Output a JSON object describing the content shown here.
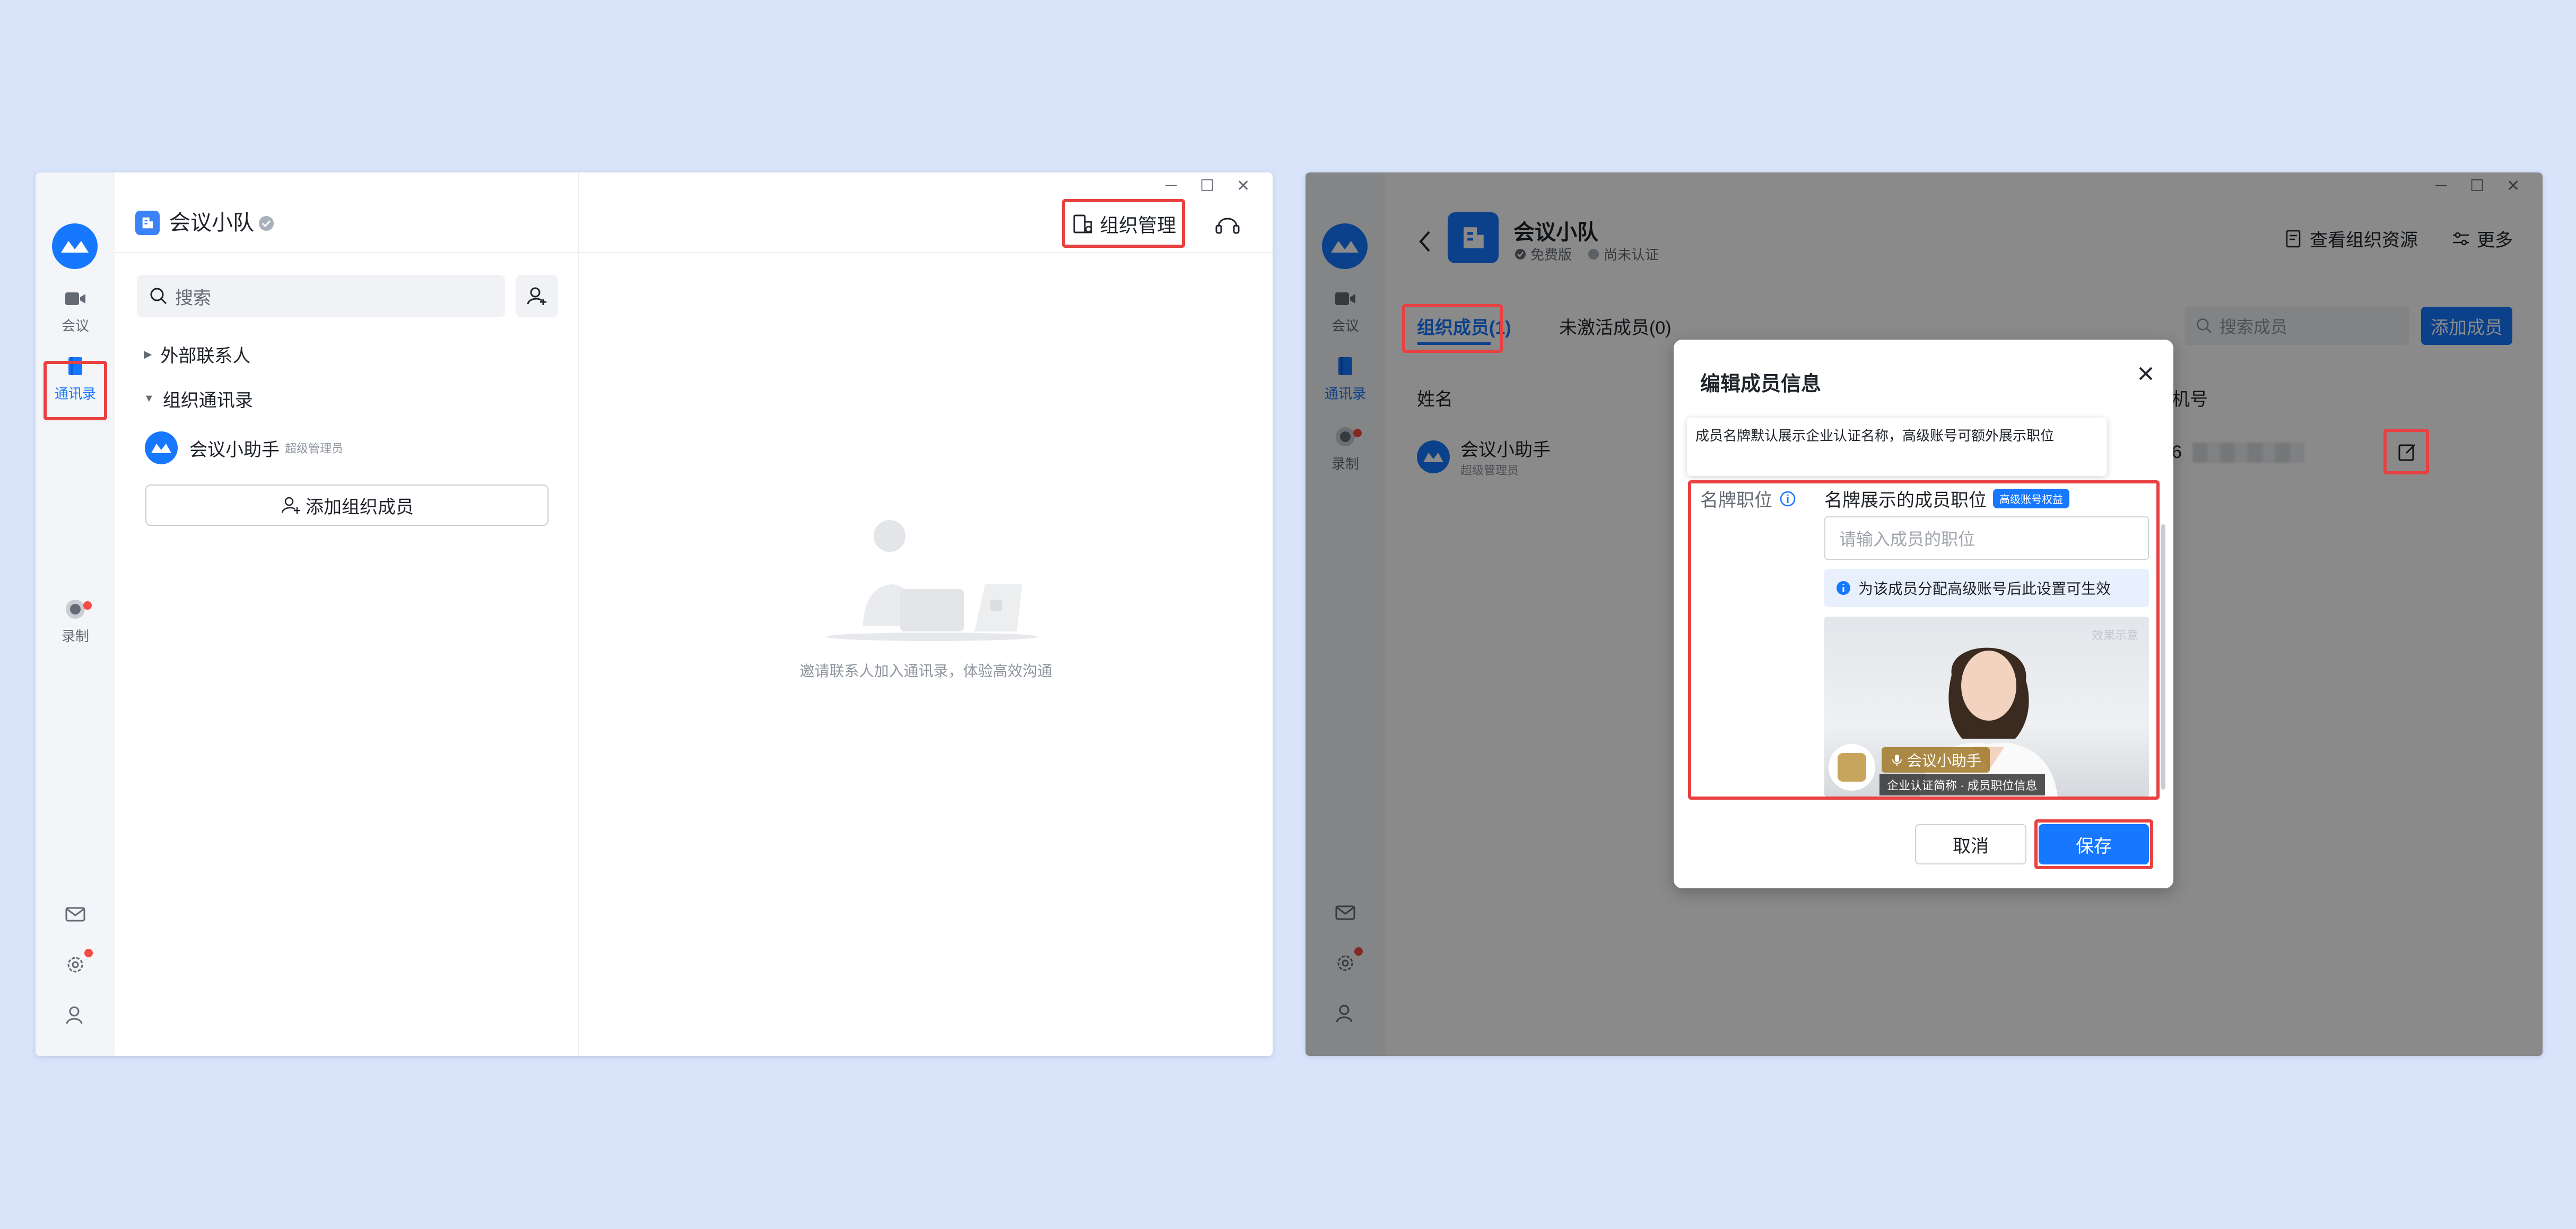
{
  "left_window": {
    "rail": {
      "meeting": "会议",
      "contacts": "通讯录",
      "record": "录制"
    },
    "title": "会议小队",
    "search_placeholder": "搜索",
    "tree": {
      "external": "外部联系人",
      "org": "组织通讯录"
    },
    "contact": {
      "name": "会议小助手",
      "role": "超级管理员"
    },
    "add_member": "添加组织成员",
    "empty_text": "邀请联系人加入通讯录，体验高效沟通",
    "org_manage": "组织管理"
  },
  "right_window": {
    "rail": {
      "meeting": "会议",
      "contacts": "通讯录",
      "record": "录制"
    },
    "org_name": "会议小队",
    "plan": "免费版",
    "cert": "尚未认证",
    "view_resources": "查看组织资源",
    "more": "更多",
    "tabs": {
      "members": "组织成员(1)",
      "inactive": "未激活成员(0)"
    },
    "search_placeholder": "搜索成员",
    "add_member": "添加成员",
    "columns": {
      "name": "姓名",
      "phone": "机号"
    },
    "member": {
      "name": "会议小助手",
      "role": "超级管理员",
      "phone_prefix": "6"
    },
    "modal": {
      "title": "编辑成员信息",
      "tooltip": "成员名牌默认展示企业认证名称，高级账号可额外展示职位",
      "label": "名牌职位",
      "field_title": "名牌展示的成员职位",
      "badge": "高级账号权益",
      "placeholder": "请输入成员的职位",
      "info": "为该成员分配高级账号后此设置可生效",
      "preview": {
        "watermark": "效果示意",
        "name": "会议小助手",
        "sub": "企业认证简称 · 成员职位信息"
      },
      "cancel": "取消",
      "save": "保存"
    }
  },
  "colors": {
    "accent": "#1677ff",
    "highlight": "#e84141",
    "background": "#d9e4fb"
  }
}
